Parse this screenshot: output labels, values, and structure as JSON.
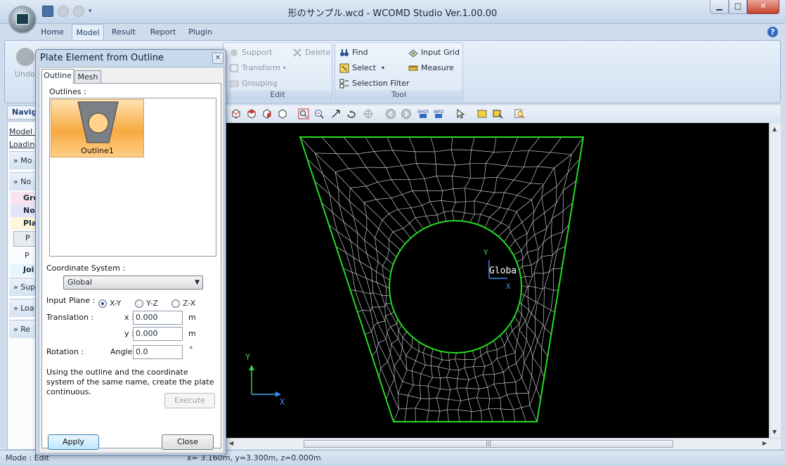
{
  "window": {
    "title": "形のサンプル.wcd - WCOMD Studio Ver.1.00.00",
    "minimize": "▁",
    "maximize": "□",
    "close": "✕"
  },
  "quick_access": {
    "menu_glyph": "▾"
  },
  "ribbon": {
    "tabs": [
      "Home",
      "Model",
      "Result",
      "Report",
      "Plugin"
    ],
    "active_tab": "Model",
    "undo_label": "Undo",
    "edit_group": {
      "label": "Edit",
      "support": "Support",
      "delete": "Delete",
      "transform": "Transform",
      "grouping": "Grouping"
    },
    "tool_group": {
      "label": "Tool",
      "find": "Find",
      "input_grid": "Input Grid",
      "select": "Select",
      "measure": "Measure",
      "selection_filter": "Selection Filter"
    }
  },
  "navigation": {
    "header": "Navig",
    "rows": [
      "Model P",
      "Loadin"
    ],
    "sections": [
      "Mo",
      "No",
      "Sup",
      "Loa",
      "Re"
    ],
    "items": [
      "Gro",
      "Noo",
      "Pla",
      "P",
      "P",
      "Joi"
    ]
  },
  "dialog": {
    "title": "Plate Element from Outline",
    "close_glyph": "✕",
    "tabs": [
      "Outline",
      "Mesh"
    ],
    "active_tab": "Outline",
    "outlines_label": "Outlines :",
    "outline_item": "Outline1",
    "coordinate_system_label": "Coordinate System :",
    "coordinate_system_value": "Global",
    "input_plane_label": "Input Plane :",
    "planes": [
      "X-Y",
      "Y-Z",
      "Z-X"
    ],
    "selected_plane": "X-Y",
    "translation_label": "Translation :",
    "x_label": "x :",
    "x_value": "0.000",
    "y_label": "y :",
    "y_value": "0.000",
    "unit_m": "m",
    "rotation_label": "Rotation :",
    "angle_label": "Angle :",
    "angle_value": "0.0",
    "unit_deg": "°",
    "note": "Using the outline and the coordinate system of the same name, create the plate continuous.",
    "execute": "Execute",
    "apply": "Apply",
    "close": "Close"
  },
  "viewport": {
    "axis_y": "Y",
    "axis_x": "X",
    "global_label": "Globa",
    "grid_color": "#c8c8c8",
    "outline_color": "#22dd22",
    "axis_color": "#3a8df0",
    "axis_y_color": "#3ad14a"
  },
  "statusbar": {
    "mode": "Mode : Edit",
    "coords": "x= 3.160m, y=3.300m, z=0.000m"
  }
}
